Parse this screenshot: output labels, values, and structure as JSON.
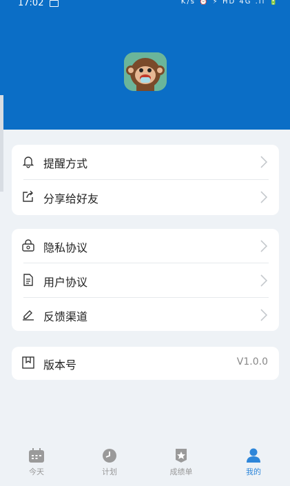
{
  "status_bar": {
    "time": "17:02",
    "icons": "K/s ⏰ ⚡ HD 4G .ıl 🔋"
  },
  "avatar": {
    "alt": "monkey-avatar"
  },
  "menu_group_1": {
    "items": [
      {
        "label": "提醒方式",
        "icon": "bell-icon"
      },
      {
        "label": "分享给好友",
        "icon": "share-icon"
      }
    ]
  },
  "menu_group_2": {
    "items": [
      {
        "label": "隐私协议",
        "icon": "lock-icon"
      },
      {
        "label": "用户协议",
        "icon": "document-icon"
      },
      {
        "label": "反馈渠道",
        "icon": "edit-icon"
      }
    ]
  },
  "version": {
    "label": "版本号",
    "value": "V1.0.0",
    "icon": "bookmark-icon"
  },
  "tabs": [
    {
      "label": "今天",
      "icon": "calendar-icon",
      "active": false
    },
    {
      "label": "计划",
      "icon": "clock-icon",
      "active": false
    },
    {
      "label": "成绩单",
      "icon": "star-badge-icon",
      "active": false
    },
    {
      "label": "我的",
      "icon": "person-icon",
      "active": true
    }
  ],
  "colors": {
    "header": "#0b6ec6",
    "background": "#eef2f6",
    "accent": "#2e86d9",
    "inactive": "#999999"
  }
}
